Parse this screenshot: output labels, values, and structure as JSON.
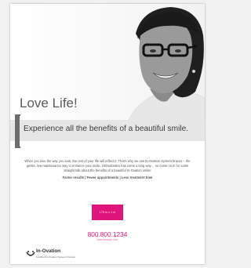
{
  "ad": {
    "headline": "Love Life!",
    "subhead": "Experience all the benefits of a beautiful smile.",
    "body": "When you love the way you look, the rest of your life will reflect it. That's why we use In-Ovation System braces – the gentle, low-maintenance way to enhance your smile. Orthodontics has come a long way… so come on in for some straight talk about the benefits of a beautiful In-Ovation smile!",
    "features": "Faster results  |  Fewer appointments  |  Less treatment time",
    "cta_box_text": "175 in x 1 in",
    "phone": "800.800.1234",
    "url": "www.website.com",
    "logo": {
      "name": "In-Ovation",
      "tagline": "Certified In-Ovation System Provider",
      "icon": "smile-logo-icon"
    },
    "colors": {
      "accent": "#e0157c",
      "background": "#ffffff",
      "band": "#e6e6e6",
      "bracket": "#6c6c6c"
    },
    "photo": "smiling-woman-with-glasses"
  }
}
